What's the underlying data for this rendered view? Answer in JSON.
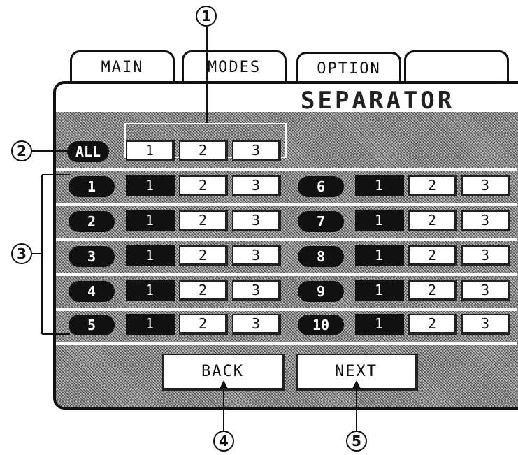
{
  "tabs": [
    "MAIN",
    "MODES",
    "OPTION",
    ""
  ],
  "screen_title": "SEPARATOR",
  "all_row": {
    "label": "ALL",
    "buttons": [
      "1",
      "2",
      "3"
    ]
  },
  "separators": [
    {
      "id": "1",
      "buttons": [
        "1",
        "2",
        "3"
      ],
      "selected": "1"
    },
    {
      "id": "2",
      "buttons": [
        "1",
        "2",
        "3"
      ],
      "selected": "1"
    },
    {
      "id": "3",
      "buttons": [
        "1",
        "2",
        "3"
      ],
      "selected": "1"
    },
    {
      "id": "4",
      "buttons": [
        "1",
        "2",
        "3"
      ],
      "selected": "1"
    },
    {
      "id": "5",
      "buttons": [
        "1",
        "2",
        "3"
      ],
      "selected": "1"
    },
    {
      "id": "6",
      "buttons": [
        "1",
        "2",
        "3"
      ],
      "selected": "1"
    },
    {
      "id": "7",
      "buttons": [
        "1",
        "2",
        "3"
      ],
      "selected": "1"
    },
    {
      "id": "8",
      "buttons": [
        "1",
        "2",
        "3"
      ],
      "selected": "1"
    },
    {
      "id": "9",
      "buttons": [
        "1",
        "2",
        "3"
      ],
      "selected": "1"
    },
    {
      "id": "10",
      "buttons": [
        "1",
        "2",
        "3"
      ],
      "selected": "1"
    }
  ],
  "nav": {
    "back": "BACK",
    "next": "NEXT"
  },
  "callouts": [
    "1",
    "2",
    "3",
    "4",
    "5"
  ]
}
